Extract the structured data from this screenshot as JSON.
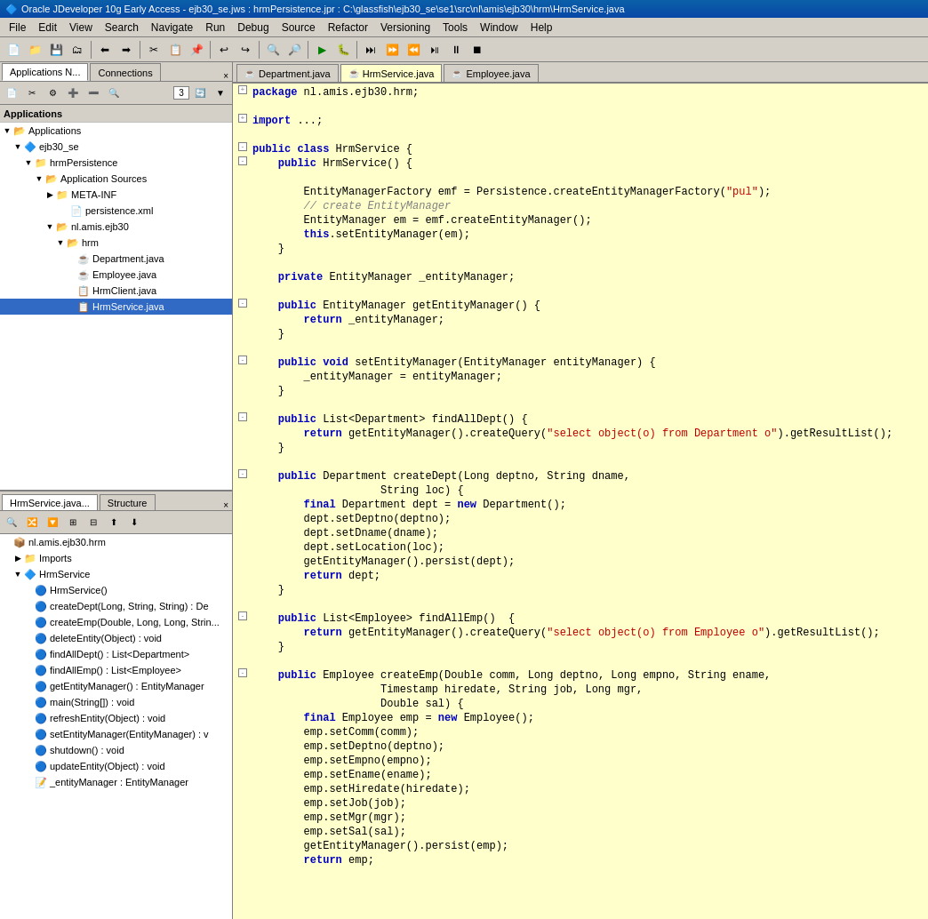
{
  "titlebar": {
    "text": "Oracle JDeveloper 10g Early Access - ejb30_se.jws : hrmPersistence.jpr : C:\\glassfish\\ejb30_se\\se1\\src\\nl\\amis\\ejb30\\hrm\\HrmService.java"
  },
  "menubar": {
    "items": [
      "File",
      "Edit",
      "View",
      "Search",
      "Navigate",
      "Run",
      "Debug",
      "Source",
      "Refactor",
      "Versioning",
      "Tools",
      "Window",
      "Help"
    ]
  },
  "left_panel": {
    "tabs": [
      {
        "label": "Applications N...",
        "active": true
      },
      {
        "label": "Connections",
        "active": false
      }
    ],
    "close_btn": "×"
  },
  "left_panel_header": {
    "label": "Applications"
  },
  "tree": {
    "items": [
      {
        "indent": 0,
        "toggle": "",
        "icon": "folder",
        "label": "Applications",
        "bold": true
      },
      {
        "indent": 1,
        "toggle": "▼",
        "icon": "project",
        "label": "ejb30_se"
      },
      {
        "indent": 2,
        "toggle": "▼",
        "icon": "folder",
        "label": "hrmPersistence"
      },
      {
        "indent": 3,
        "toggle": "▼",
        "icon": "folder",
        "label": "Application Sources"
      },
      {
        "indent": 4,
        "toggle": "▶",
        "icon": "folder",
        "label": "META-INF"
      },
      {
        "indent": 5,
        "toggle": "",
        "icon": "xml",
        "label": "persistence.xml"
      },
      {
        "indent": 4,
        "toggle": "▼",
        "icon": "folder",
        "label": "nl.amis.ejb30"
      },
      {
        "indent": 5,
        "toggle": "▼",
        "icon": "folder",
        "label": "hrm"
      },
      {
        "indent": 6,
        "toggle": "",
        "icon": "java",
        "label": "Department.java"
      },
      {
        "indent": 6,
        "toggle": "",
        "icon": "java",
        "label": "Employee.java"
      },
      {
        "indent": 6,
        "toggle": "",
        "icon": "java",
        "label": "HrmClient.java"
      },
      {
        "indent": 6,
        "toggle": "",
        "icon": "java",
        "label": "HrmService.java",
        "selected": true
      }
    ]
  },
  "bottom_panel": {
    "tabs": [
      {
        "label": "HrmService.java...",
        "active": true
      },
      {
        "label": "Structure",
        "active": false
      }
    ],
    "close_btn": "×",
    "tree_items": [
      {
        "indent": 0,
        "toggle": "",
        "icon": "pkg",
        "label": "nl.amis.ejb30.hrm"
      },
      {
        "indent": 1,
        "toggle": "▶",
        "icon": "folder",
        "label": "Imports"
      },
      {
        "indent": 1,
        "toggle": "▼",
        "icon": "class",
        "label": "HrmService"
      },
      {
        "indent": 2,
        "toggle": "",
        "icon": "method",
        "label": "HrmService()"
      },
      {
        "indent": 2,
        "toggle": "",
        "icon": "method",
        "label": "createDept(Long, String, String) : De"
      },
      {
        "indent": 2,
        "toggle": "",
        "icon": "method",
        "label": "createEmp(Double, Long, Long, Strin..."
      },
      {
        "indent": 2,
        "toggle": "",
        "icon": "method",
        "label": "deleteEntity(Object) : void"
      },
      {
        "indent": 2,
        "toggle": "",
        "icon": "method",
        "label": "findAllDept() : List<Department>"
      },
      {
        "indent": 2,
        "toggle": "",
        "icon": "method",
        "label": "findAllEmp() : List<Employee>"
      },
      {
        "indent": 2,
        "toggle": "",
        "icon": "method",
        "label": "getEntityManager() : EntityManager"
      },
      {
        "indent": 2,
        "toggle": "",
        "icon": "method",
        "label": "main(String[]) : void"
      },
      {
        "indent": 2,
        "toggle": "",
        "icon": "method",
        "label": "refreshEntity(Object) : void"
      },
      {
        "indent": 2,
        "toggle": "",
        "icon": "method",
        "label": "setEntityManager(EntityManager) : v"
      },
      {
        "indent": 2,
        "toggle": "",
        "icon": "method",
        "label": "shutdown() : void"
      },
      {
        "indent": 2,
        "toggle": "",
        "icon": "method",
        "label": "updateEntity(Object) : void"
      },
      {
        "indent": 2,
        "toggle": "",
        "icon": "field",
        "label": "_entityManager : EntityManager"
      }
    ]
  },
  "editor": {
    "tabs": [
      {
        "label": "Department.java",
        "icon": "☕",
        "active": false
      },
      {
        "label": "HrmService.java",
        "icon": "☕",
        "active": true
      },
      {
        "label": "Employee.java",
        "icon": "☕",
        "active": false
      }
    ],
    "code": [
      {
        "fold": "+",
        "text": "package nl.amis.ejb30.hrm;",
        "type": "normal"
      },
      {
        "fold": "",
        "text": "",
        "type": "normal"
      },
      {
        "fold": "+",
        "text": "import ...;",
        "type": "kw_import"
      },
      {
        "fold": "",
        "text": "",
        "type": "normal"
      },
      {
        "fold": "-",
        "text": "public class HrmService {",
        "type": "class_decl"
      },
      {
        "fold": "-",
        "text": "    public HrmService() {",
        "type": "method_decl"
      },
      {
        "fold": "",
        "text": "",
        "type": "normal"
      },
      {
        "fold": "",
        "text": "        EntityManagerFactory emf = Persistence.createEntityManagerFactory(\"pul\");",
        "type": "body"
      },
      {
        "fold": "",
        "text": "        // create EntityManager",
        "type": "comment"
      },
      {
        "fold": "",
        "text": "        EntityManager em = emf.createEntityManager();",
        "type": "body"
      },
      {
        "fold": "",
        "text": "        this.setEntityManager(em);",
        "type": "body"
      },
      {
        "fold": "",
        "text": "    }",
        "type": "normal"
      },
      {
        "fold": "",
        "text": "",
        "type": "normal"
      },
      {
        "fold": "",
        "text": "    private EntityManager _entityManager;",
        "type": "field"
      },
      {
        "fold": "",
        "text": "",
        "type": "normal"
      },
      {
        "fold": "-",
        "text": "    public EntityManager getEntityManager() {",
        "type": "method_decl"
      },
      {
        "fold": "",
        "text": "        return _entityManager;",
        "type": "body"
      },
      {
        "fold": "",
        "text": "    }",
        "type": "normal"
      },
      {
        "fold": "",
        "text": "",
        "type": "normal"
      },
      {
        "fold": "-",
        "text": "    public void setEntityManager(EntityManager entityManager) {",
        "type": "method_decl"
      },
      {
        "fold": "",
        "text": "        _entityManager = entityManager;",
        "type": "body"
      },
      {
        "fold": "",
        "text": "    }",
        "type": "normal"
      },
      {
        "fold": "",
        "text": "",
        "type": "normal"
      },
      {
        "fold": "-",
        "text": "    public List<Department> findAllDept() {",
        "type": "method_decl"
      },
      {
        "fold": "",
        "text": "        return getEntityManager().createQuery(\"select object(o) from Department o\").getResultList();",
        "type": "body_query"
      },
      {
        "fold": "",
        "text": "    }",
        "type": "normal"
      },
      {
        "fold": "",
        "text": "",
        "type": "normal"
      },
      {
        "fold": "-",
        "text": "    public Department createDept(Long deptno, String dname,",
        "type": "method_decl"
      },
      {
        "fold": "",
        "text": "                    String loc) {",
        "type": "body"
      },
      {
        "fold": "",
        "text": "        final Department dept = new Department();",
        "type": "body"
      },
      {
        "fold": "",
        "text": "        dept.setDeptno(deptno);",
        "type": "body"
      },
      {
        "fold": "",
        "text": "        dept.setDname(dname);",
        "type": "body"
      },
      {
        "fold": "",
        "text": "        dept.setLocation(loc);",
        "type": "body"
      },
      {
        "fold": "",
        "text": "        getEntityManager().persist(dept);",
        "type": "body"
      },
      {
        "fold": "",
        "text": "        return dept;",
        "type": "body"
      },
      {
        "fold": "",
        "text": "    }",
        "type": "normal"
      },
      {
        "fold": "",
        "text": "",
        "type": "normal"
      },
      {
        "fold": "-",
        "text": "    public List<Employee> findAllEmp()  {",
        "type": "method_decl"
      },
      {
        "fold": "",
        "text": "        return getEntityManager().createQuery(\"select object(o) from Employee o\").getResultList();",
        "type": "body_query"
      },
      {
        "fold": "",
        "text": "    }",
        "type": "normal"
      },
      {
        "fold": "",
        "text": "",
        "type": "normal"
      },
      {
        "fold": "-",
        "text": "    public Employee createEmp(Double comm, Long deptno, Long empno, String ename,",
        "type": "method_decl"
      },
      {
        "fold": "",
        "text": "                    Timestamp hiredate, String job, Long mgr,",
        "type": "body"
      },
      {
        "fold": "",
        "text": "                    Double sal) {",
        "type": "body"
      },
      {
        "fold": "",
        "text": "        final Employee emp = new Employee();",
        "type": "body"
      },
      {
        "fold": "",
        "text": "        emp.setComm(comm);",
        "type": "body"
      },
      {
        "fold": "",
        "text": "        emp.setDeptno(deptno);",
        "type": "body"
      },
      {
        "fold": "",
        "text": "        emp.setEmpno(empno);",
        "type": "body"
      },
      {
        "fold": "",
        "text": "        emp.setEname(ename);",
        "type": "body"
      },
      {
        "fold": "",
        "text": "        emp.setHiredate(hiredate);",
        "type": "body"
      },
      {
        "fold": "",
        "text": "        emp.setJob(job);",
        "type": "body"
      },
      {
        "fold": "",
        "text": "        emp.setMgr(mgr);",
        "type": "body"
      },
      {
        "fold": "",
        "text": "        emp.setSal(sal);",
        "type": "body"
      },
      {
        "fold": "",
        "text": "        getEntityManager().persist(emp);",
        "type": "body"
      },
      {
        "fold": "",
        "text": "        return emp;",
        "type": "body"
      }
    ]
  },
  "toolbar": {
    "buttons": [
      "📁",
      "💾",
      "✂",
      "📋",
      "↩",
      "↪",
      "▶",
      "⏸",
      "⏹"
    ]
  }
}
